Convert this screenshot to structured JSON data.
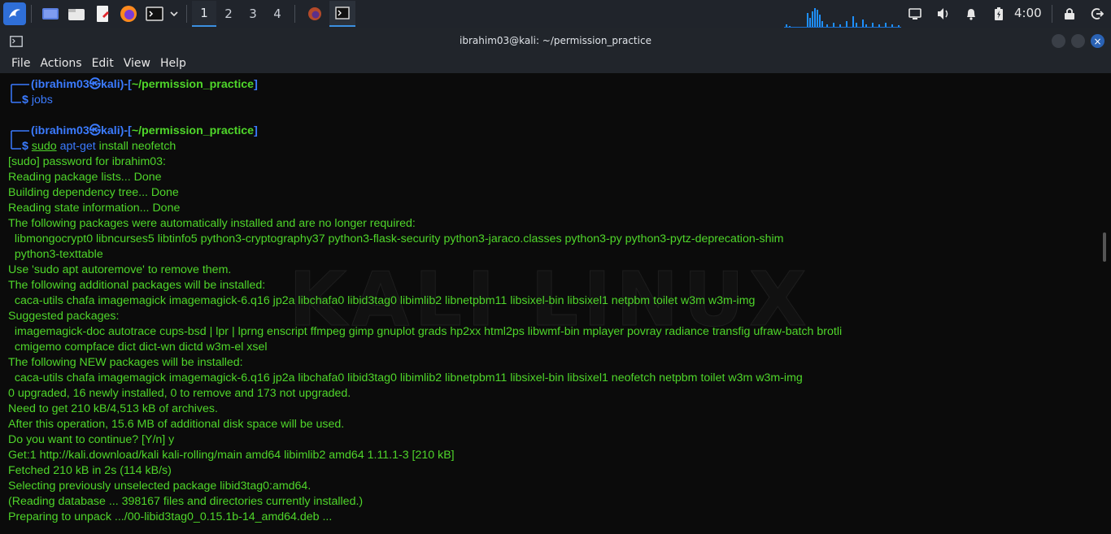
{
  "panel": {
    "workspaces": [
      "1",
      "2",
      "3",
      "4"
    ],
    "active_workspace": "1",
    "clock": "4:00"
  },
  "window": {
    "title": "ibrahim03@kali: ~/permission_practice",
    "close_glyph": "×"
  },
  "menu": [
    "File",
    "Actions",
    "Edit",
    "View",
    "Help"
  ],
  "prompt": {
    "user": "ibrahim03",
    "at": "㉿",
    "host": "kali",
    "path": "~/permission_practice",
    "dollar": "$"
  },
  "commands": {
    "first": "jobs",
    "second_sudo": "sudo",
    "second_apt": "apt-get",
    "second_rest": " install neofetch"
  },
  "output": [
    "[sudo] password for ibrahim03:",
    "Reading package lists... Done",
    "Building dependency tree... Done",
    "Reading state information... Done",
    "The following packages were automatically installed and are no longer required:",
    "  libmongocrypt0 libncurses5 libtinfo5 python3-cryptography37 python3-flask-security python3-jaraco.classes python3-py python3-pytz-deprecation-shim",
    "  python3-texttable",
    "Use 'sudo apt autoremove' to remove them.",
    "The following additional packages will be installed:",
    "  caca-utils chafa imagemagick imagemagick-6.q16 jp2a libchafa0 libid3tag0 libimlib2 libnetpbm11 libsixel-bin libsixel1 netpbm toilet w3m w3m-img",
    "Suggested packages:",
    "  imagemagick-doc autotrace cups-bsd | lpr | lprng enscript ffmpeg gimp gnuplot grads hp2xx html2ps libwmf-bin mplayer povray radiance transfig ufraw-batch brotli",
    "  cmigemo compface dict dict-wn dictd w3m-el xsel",
    "The following NEW packages will be installed:",
    "  caca-utils chafa imagemagick imagemagick-6.q16 jp2a libchafa0 libid3tag0 libimlib2 libnetpbm11 libsixel-bin libsixel1 neofetch netpbm toilet w3m w3m-img",
    "0 upgraded, 16 newly installed, 0 to remove and 173 not upgraded.",
    "Need to get 210 kB/4,513 kB of archives.",
    "After this operation, 15.6 MB of additional disk space will be used.",
    "Do you want to continue? [Y/n] y",
    "Get:1 http://kali.download/kali kali-rolling/main amd64 libimlib2 amd64 1.11.1-3 [210 kB]",
    "Fetched 210 kB in 2s (114 kB/s)",
    "Selecting previously unselected package libid3tag0:amd64.",
    "(Reading database ... 398167 files and directories currently installed.)",
    "Preparing to unpack .../00-libid3tag0_0.15.1b-14_amd64.deb ..."
  ],
  "watermark": "KALI LINUX",
  "colors": {
    "prompt_blue": "#3b7bff",
    "output_green": "#4fd62a",
    "accent": "#3b8fe0"
  }
}
